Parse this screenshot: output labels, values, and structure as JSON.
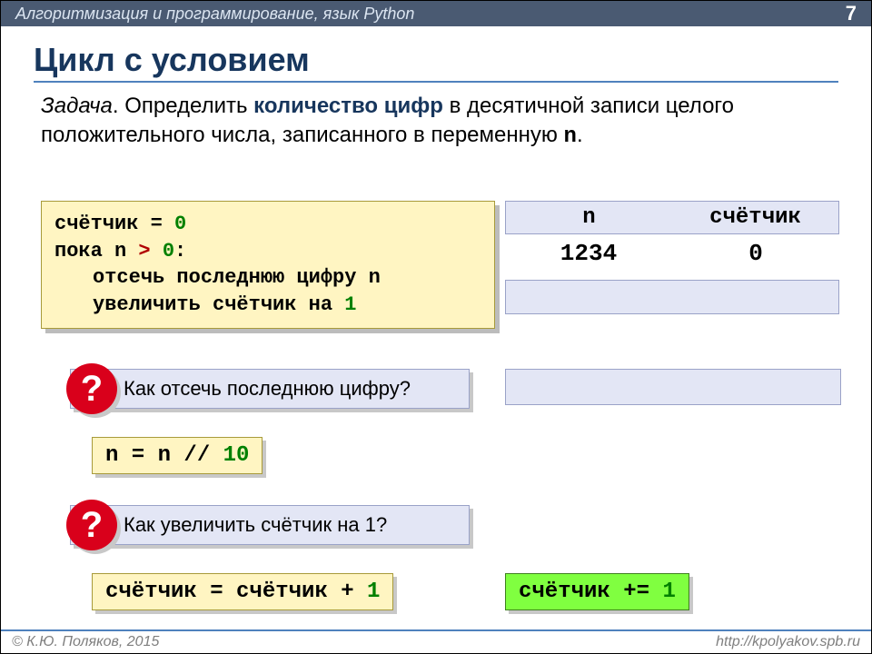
{
  "header": {
    "subject": "Алгоритмизация и программирование, язык Python",
    "page": "7"
  },
  "title": "Цикл с условием",
  "task": {
    "label": "Задача",
    "pre": ". Определить ",
    "bold": "количество цифр",
    "post1": " в десятичной записи целого положительного числа, записанного в переменную ",
    "var": "n",
    "post2": "."
  },
  "code": {
    "l1a": "счётчик = ",
    "l1n": "0",
    "l2a": "пока n ",
    "l2op": ">",
    "l2b": " ",
    "l2n": "0",
    "l2c": ":",
    "l3": "отсечь последнюю цифру n",
    "l4a": "увеличить счётчик на ",
    "l4n": "1"
  },
  "table": {
    "h1": "n",
    "h2": "счётчик",
    "c1": "1234",
    "c2": "0"
  },
  "q1": {
    "mark": "?",
    "text": "Как отсечь последнюю цифру?"
  },
  "a1": {
    "pre": "n = n // ",
    "num": "10"
  },
  "q2": {
    "mark": "?",
    "text": "Как увеличить счётчик на 1?"
  },
  "a2": {
    "pre": "счётчик = счётчик + ",
    "num": "1"
  },
  "a3": {
    "pre": "счётчик += ",
    "num": "1"
  },
  "footer": {
    "left": "© К.Ю. Поляков, 2015",
    "right": "http://kpolyakov.spb.ru"
  }
}
